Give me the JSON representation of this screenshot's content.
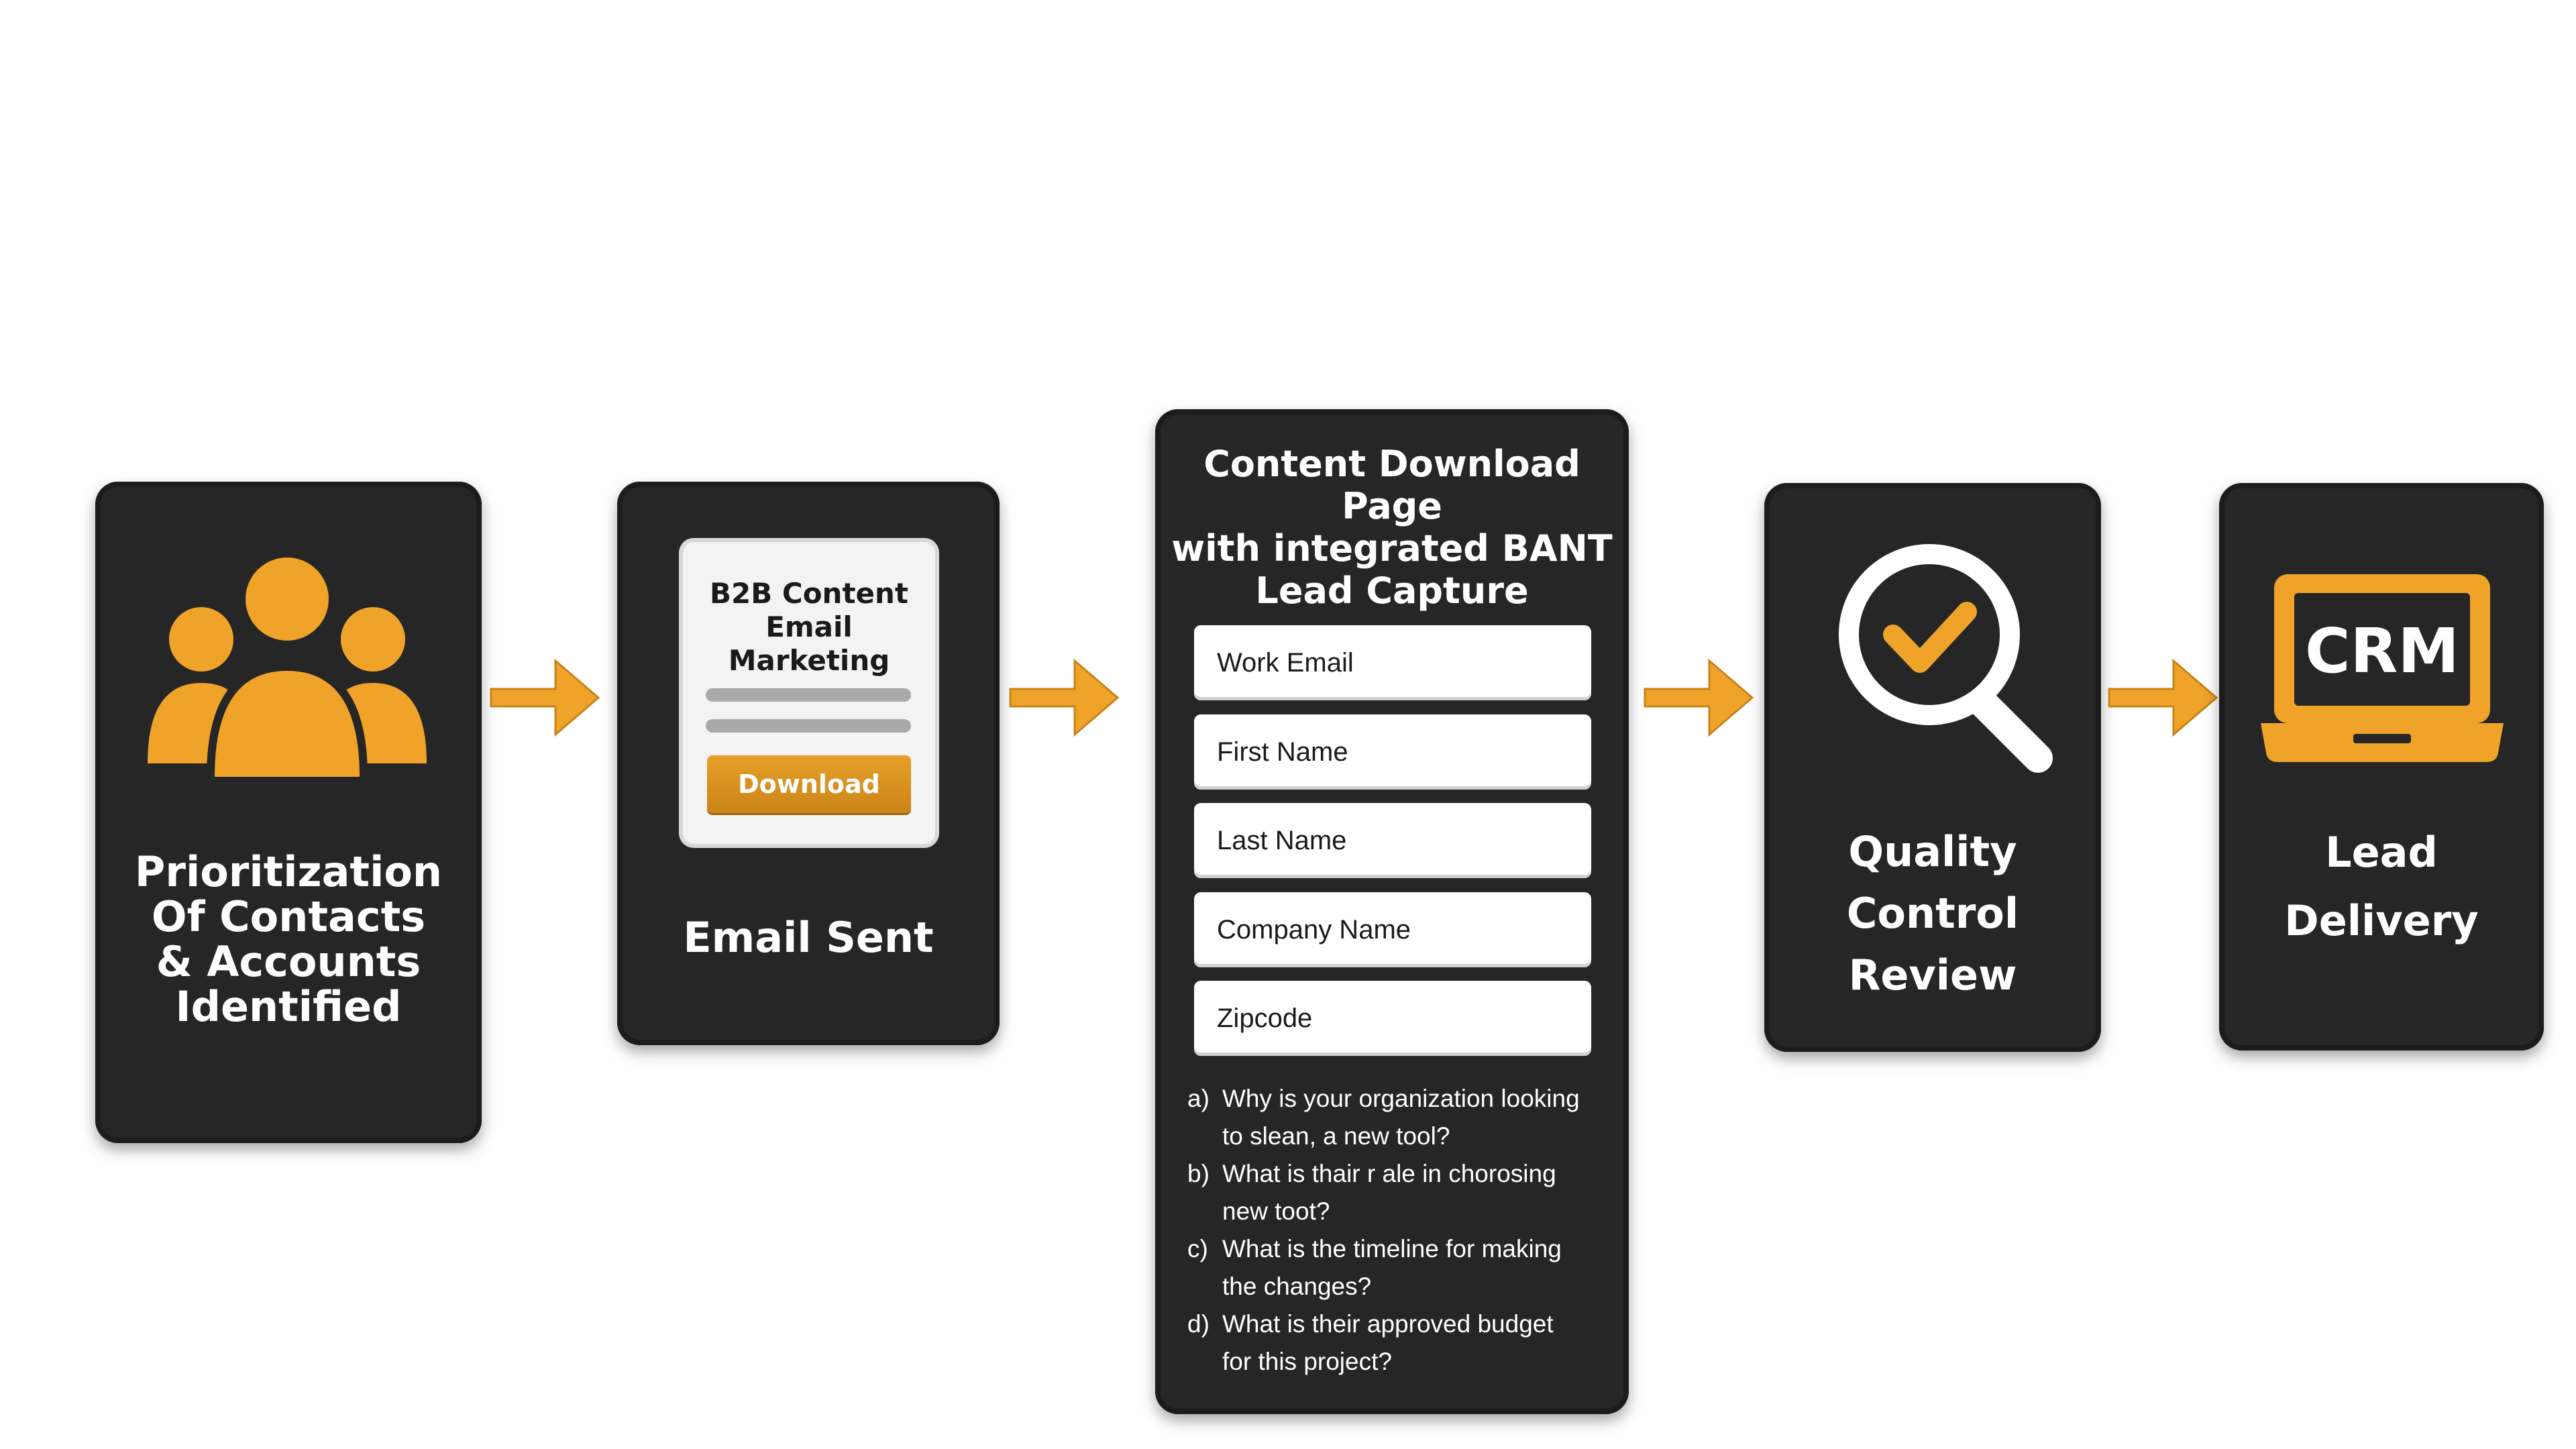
{
  "steps": [
    {
      "label_lines": [
        "Prioritization",
        "Of Contacts",
        "& Accounts",
        "Identified"
      ],
      "icon": "people-group-icon"
    },
    {
      "label": "Email Sent",
      "icon": "email-mockup"
    },
    {
      "label": "Content Download Page",
      "icon": "form"
    },
    {
      "label_lines": [
        "Quality",
        "Control",
        "Review"
      ],
      "icon": "magnifier-check-icon"
    },
    {
      "label_lines": [
        "Lead",
        "Delivery"
      ],
      "icon": "crm-laptop-icon"
    }
  ],
  "email_mockup": {
    "title_lines": [
      "B2B Content",
      "Email Marketing"
    ],
    "button_label": "Download"
  },
  "form": {
    "title_lines": [
      "Content Download Page",
      "with integrated BANT",
      "Lead Capture"
    ],
    "fields": [
      "Work Email",
      "First Name",
      "Last Name",
      "Company Name",
      "Zipcode"
    ],
    "questions": [
      {
        "letter": "a)",
        "lines": [
          "Why is your organization looking",
          "to slean, a new tool?"
        ]
      },
      {
        "letter": "b)",
        "lines": [
          "What is thair r ale in chorosing",
          "new toot?"
        ]
      },
      {
        "letter": "c)",
        "lines": [
          "What is the timeline for making",
          "the changes?"
        ]
      },
      {
        "letter": "d)",
        "lines": [
          "What is their approved budget",
          "for this project?"
        ]
      }
    ]
  },
  "crm_label": "CRM",
  "colors": {
    "accent": "#f0a329",
    "card": "#262626",
    "text": "#ffffff"
  }
}
